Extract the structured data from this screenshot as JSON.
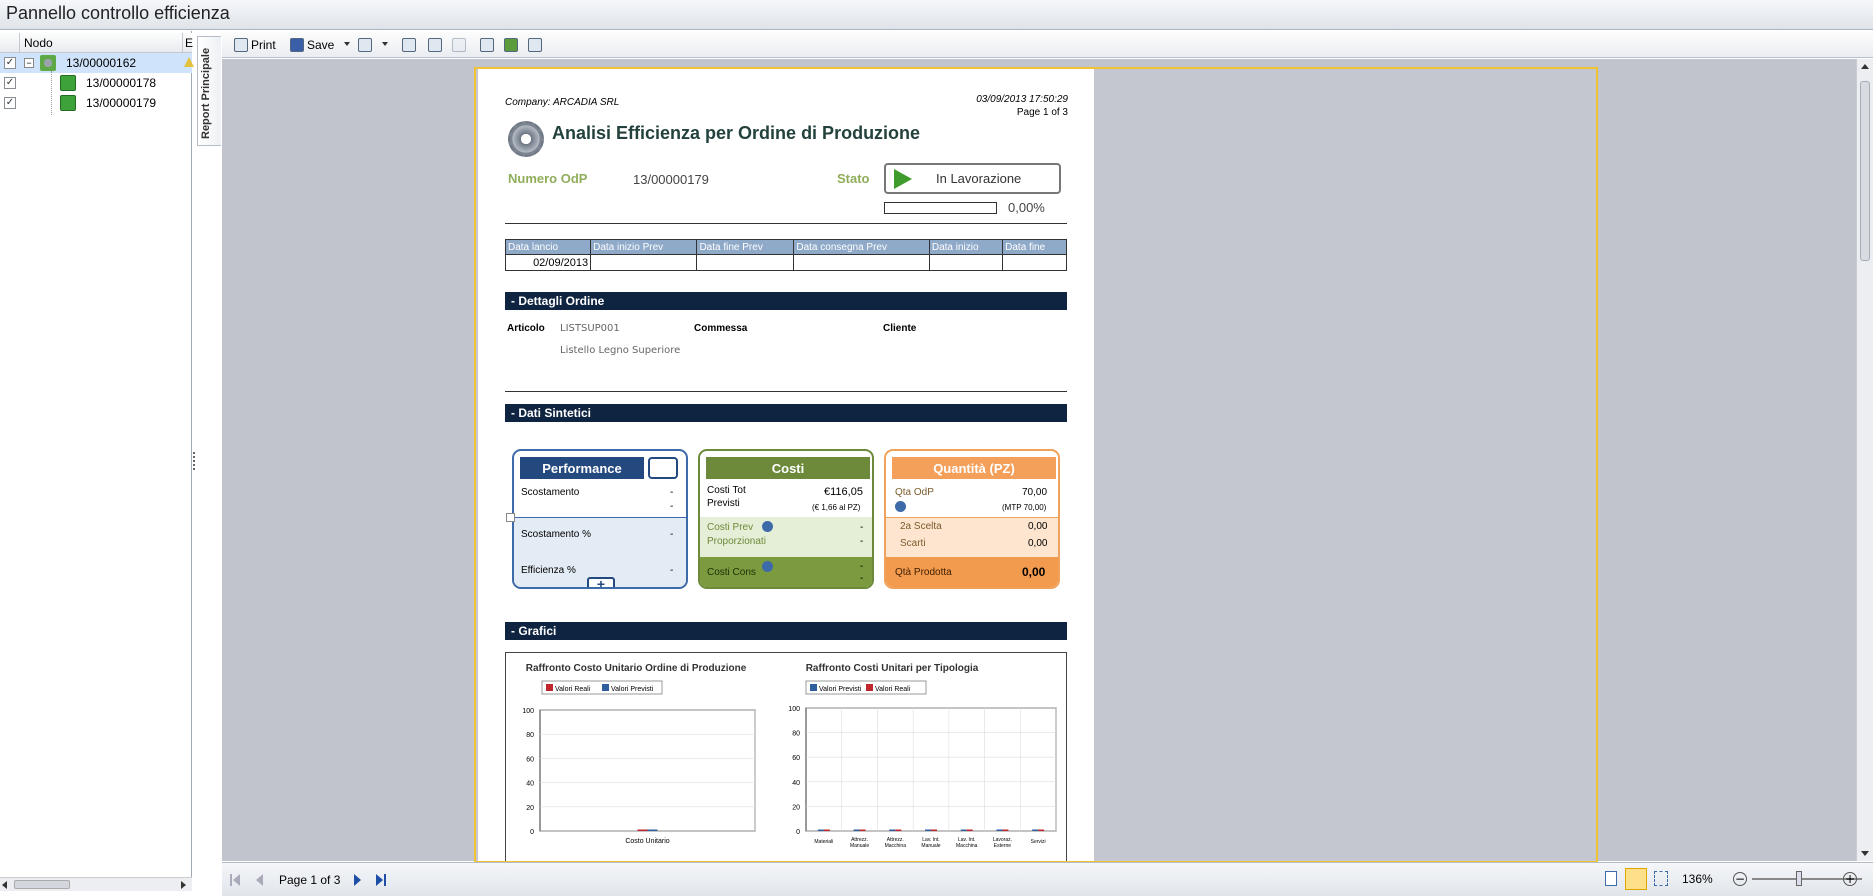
{
  "window": {
    "title": "Pannello controllo efficienza"
  },
  "tree": {
    "header": {
      "col_node": "Nodo",
      "col_extra": "E"
    },
    "items": [
      {
        "label": "13/00000162",
        "checked": "✓",
        "selected": true,
        "expander": "−"
      },
      {
        "label": "13/00000178",
        "checked": "✓"
      },
      {
        "label": "13/00000179",
        "checked": "✓"
      }
    ]
  },
  "side_tab": {
    "label": "Report Principale"
  },
  "toolbar": {
    "print": "Print",
    "save": "Save"
  },
  "report": {
    "company": "Company: ARCADIA SRL",
    "datetime": "03/09/2013 17:50:29",
    "page_info": "Page 1 of 3",
    "title": "Analisi Efficienza per Ordine di Produzione",
    "numero_label": "Numero OdP",
    "numero_value": "13/00000179",
    "stato_label": "Stato",
    "stato_value": "In Lavorazione",
    "progress_text": "0,00%",
    "progress_fraction": 0,
    "dates": {
      "headers": [
        "Data lancio",
        "Data inizio Prev",
        "Data fine Prev",
        "Data consegna Prev",
        "Data inizio",
        "Data fine"
      ],
      "values": [
        "02/09/2013",
        "",
        "",
        "",
        "",
        ""
      ]
    },
    "sections": {
      "dettagli": "- Dettagli Ordine",
      "sintetici": "- Dati Sintetici",
      "grafici": "- Grafici"
    },
    "dettagli": {
      "articolo_label": "Articolo",
      "articolo_code": "LISTSUP001",
      "articolo_desc": "Listello Legno Superiore",
      "commessa_label": "Commessa",
      "cliente_label": "Cliente"
    },
    "performance": {
      "title": "Performance",
      "scostamento_label": "Scostamento",
      "scostamento_value": "-",
      "scostamento_value2": "-",
      "scost_pct_label": "Scostamento %",
      "scost_pct_value": "-",
      "efficienza_label": "Efficienza %",
      "efficienza_value": "-"
    },
    "costi": {
      "title": "Costi",
      "tot_prev_label1": "Costi Tot",
      "tot_prev_label2": "Previsti",
      "tot_prev_value": "€116,05",
      "tot_prev_sub": "(€ 1,66 al PZ)",
      "prev_prop_label1": "Costi Prev",
      "prev_prop_label2": "Proporzionati",
      "prev_prop_value1": "-",
      "prev_prop_value2": "-",
      "cons_label": "Costi Cons",
      "cons_value1": "-",
      "cons_value2": "-"
    },
    "quantita": {
      "title": "Quantità (PZ)",
      "qta_odp_label": "Qta OdP",
      "qta_odp_value": "70,00",
      "mtp": "(MTP 70,00)",
      "seconda_label": "2a Scelta",
      "seconda_value": "0,00",
      "scarti_label": "Scarti",
      "scarti_value": "0,00",
      "prodotta_label": "Qtà Prodotta",
      "prodotta_value": "0,00"
    },
    "icons": {
      "gear": "gear-icon",
      "play": "play-icon",
      "info": "info-icon"
    }
  },
  "chart_data": [
    {
      "type": "bar",
      "title": "Raffronto Costo Unitario Ordine di Produzione",
      "categories": [
        "Costo Unitario"
      ],
      "series": [
        {
          "name": "Valori Reali",
          "values": [
            0
          ],
          "color": "#c0262c"
        },
        {
          "name": "Valori Previsti",
          "values": [
            0
          ],
          "color": "#2f5f9e"
        }
      ],
      "yticks": [
        "100",
        "80",
        "60",
        "40",
        "20",
        "0"
      ],
      "ylim": [
        0,
        100
      ],
      "grid": true,
      "legend": "top-left"
    },
    {
      "type": "bar",
      "title": "Raffronto Costi Unitari per Tipologia",
      "categories": [
        "Materiali",
        "Attrezz. Manuale",
        "Attrezz. Macchina",
        "Lav. Int. Manuale",
        "Lav. Int. Macchina",
        "Lavoraz. Esterne",
        "Servizi"
      ],
      "series": [
        {
          "name": "Valori Previsti",
          "values": [
            0,
            0,
            0,
            0,
            0,
            0,
            0
          ],
          "color": "#2f5f9e"
        },
        {
          "name": "Valori Reali",
          "values": [
            0,
            0,
            0,
            0,
            0,
            0,
            0
          ],
          "color": "#c0262c"
        }
      ],
      "yticks": [
        "100",
        "80",
        "60",
        "40",
        "20",
        "0"
      ],
      "ylim": [
        0,
        100
      ],
      "grid": true,
      "legend": "top-left"
    }
  ],
  "statusbar": {
    "page_text": "Page 1 of 3",
    "zoom": "136%",
    "zoom_minus": "−",
    "zoom_plus": "+"
  }
}
